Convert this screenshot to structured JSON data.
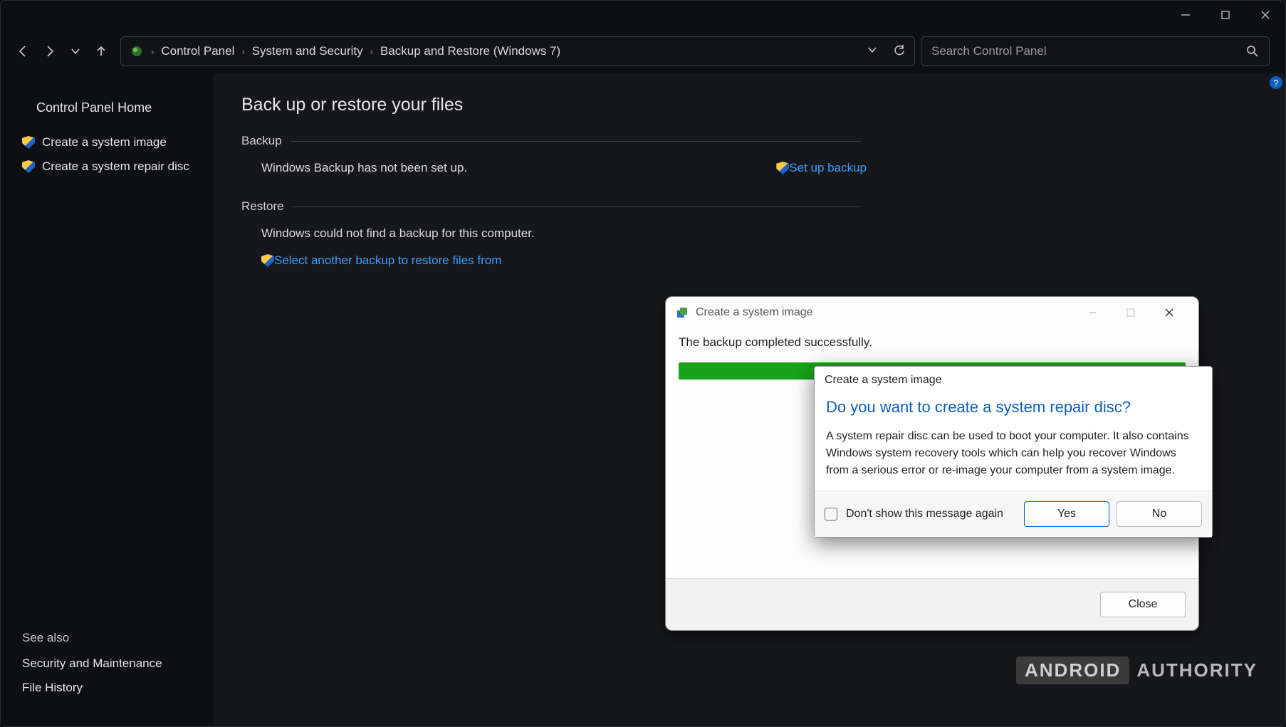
{
  "breadcrumb": {
    "root": "Control Panel",
    "mid": "System and Security",
    "leaf": "Backup and Restore (Windows 7)"
  },
  "search": {
    "placeholder": "Search Control Panel"
  },
  "sidebar": {
    "home": "Control Panel Home",
    "links": [
      "Create a system image",
      "Create a system repair disc"
    ],
    "see_also_hdr": "See also",
    "see_also": [
      "Security and Maintenance",
      "File History"
    ]
  },
  "page": {
    "title": "Back up or restore your files",
    "backup_hdr": "Backup",
    "backup_status": "Windows Backup has not been set up.",
    "setup_link": "Set up backup",
    "restore_hdr": "Restore",
    "restore_status": "Windows could not find a backup for this computer.",
    "restore_link": "Select another backup to restore files from"
  },
  "dialog1": {
    "title": "Create a system image",
    "message": "The backup completed successfully.",
    "close": "Close"
  },
  "dialog2": {
    "title": "Create a system image",
    "heading": "Do you want to create a system repair disc?",
    "body": "A system repair disc can be used to boot your computer. It also contains Windows system recovery tools which can help you recover Windows from a serious error or re-image your computer from a system image.",
    "dontshow": "Don't show this message again",
    "yes": "Yes",
    "no": "No"
  },
  "watermark": {
    "a": "ANDROID",
    "b": "AUTHORITY"
  },
  "help": "?"
}
